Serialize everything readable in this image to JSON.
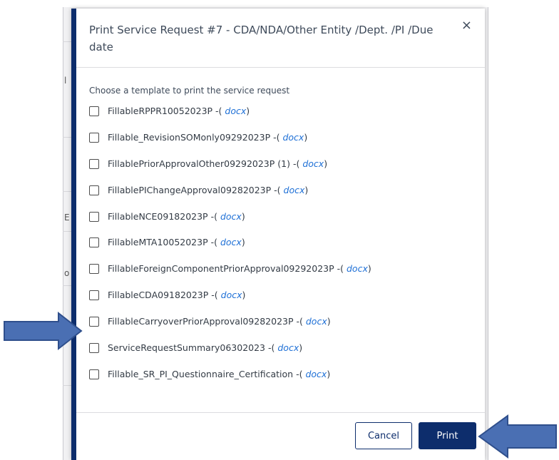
{
  "modal": {
    "title": "Print Service Request #7 - CDA/NDA/Other Entity /Dept. /PI /Due date",
    "close_symbol": "×",
    "instruction": "Choose a template to print the service request",
    "templates": [
      {
        "name": "FillableRPPR10052023P",
        "suffix_open": " -( ",
        "link": "docx",
        "suffix_close": ")"
      },
      {
        "name": "Fillable_RevisionSOMonly09292023P",
        "suffix_open": " -( ",
        "link": "docx",
        "suffix_close": ")"
      },
      {
        "name": "FillablePriorApprovalOther09292023P (1)",
        "suffix_open": " -( ",
        "link": "docx",
        "suffix_close": ")"
      },
      {
        "name": "FillablePIChangeApproval09282023P",
        "suffix_open": " -( ",
        "link": "docx",
        "suffix_close": ")"
      },
      {
        "name": "FillableNCE09182023P",
        "suffix_open": " -( ",
        "link": "docx",
        "suffix_close": ")"
      },
      {
        "name": "FillableMTA10052023P",
        "suffix_open": " -( ",
        "link": "docx",
        "suffix_close": ")"
      },
      {
        "name": "FillableForeignComponentPriorApproval09292023P",
        "suffix_open": " -( ",
        "link": "docx",
        "suffix_close": ")"
      },
      {
        "name": "FillableCDA09182023P",
        "suffix_open": " -( ",
        "link": "docx",
        "suffix_close": ")"
      },
      {
        "name": "FillableCarryoverPriorApproval09282023P",
        "suffix_open": " -( ",
        "link": "docx",
        "suffix_close": ")"
      },
      {
        "name": "ServiceRequestSummary06302023",
        "suffix_open": " -( ",
        "link": "docx",
        "suffix_close": ")"
      },
      {
        "name": "Fillable_SR_PI_Questionnaire_Certification",
        "suffix_open": " -( ",
        "link": "docx",
        "suffix_close": ")"
      }
    ],
    "cancel_label": "Cancel",
    "print_label": "Print"
  },
  "background_fragments": [
    "l",
    "E",
    "o"
  ],
  "colors": {
    "accent": "#0d2d6c",
    "link": "#1d6fd6",
    "arrow": "#4a6fb3"
  },
  "annotations": [
    "arrow-pointing-to-carryover-template",
    "arrow-pointing-to-print-button"
  ]
}
